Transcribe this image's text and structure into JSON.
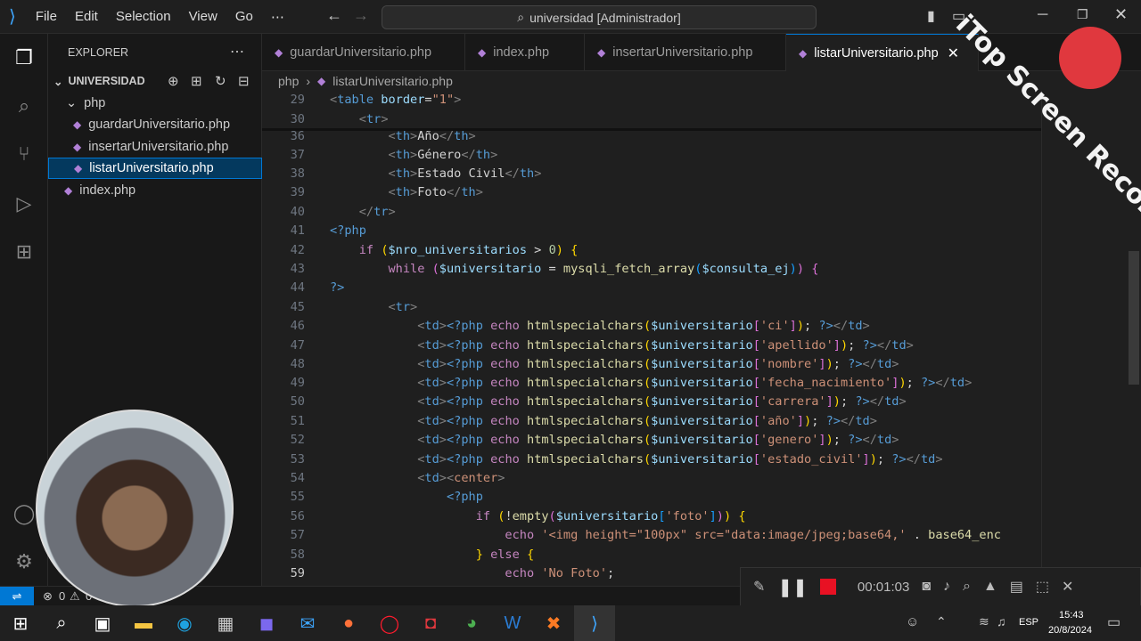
{
  "titlebar": {
    "menus": [
      "File",
      "Edit",
      "Selection",
      "View",
      "Go",
      "⋯"
    ],
    "search": "universidad [Administrador]"
  },
  "explorer": {
    "title": "EXPLORER",
    "root": "UNIVERSIDAD",
    "folder": "php",
    "files": [
      "guardarUniversitario.php",
      "insertarUniversitario.php",
      "listarUniversitario.php"
    ],
    "root_file": "index.php"
  },
  "tabs": [
    "guardarUniversitario.php",
    "index.php",
    "insertarUniversitario.php",
    "listarUniversitario.php"
  ],
  "breadcrumb": {
    "folder": "php",
    "file": "listarUniversitario.php"
  },
  "lines": [
    "29",
    "30",
    "36",
    "37",
    "38",
    "39",
    "40",
    "41",
    "42",
    "43",
    "44",
    "45",
    "46",
    "47",
    "48",
    "49",
    "50",
    "51",
    "52",
    "53",
    "54",
    "55",
    "56",
    "57",
    "58",
    "59"
  ],
  "status": {
    "errors": "0",
    "warnings": "0"
  },
  "recorder": {
    "time": "00:01:03",
    "watermark": "iTop Screen Recorder"
  },
  "taskbar": {
    "lang": "ESP",
    "time": "15:43",
    "date": "20/8/2024"
  }
}
